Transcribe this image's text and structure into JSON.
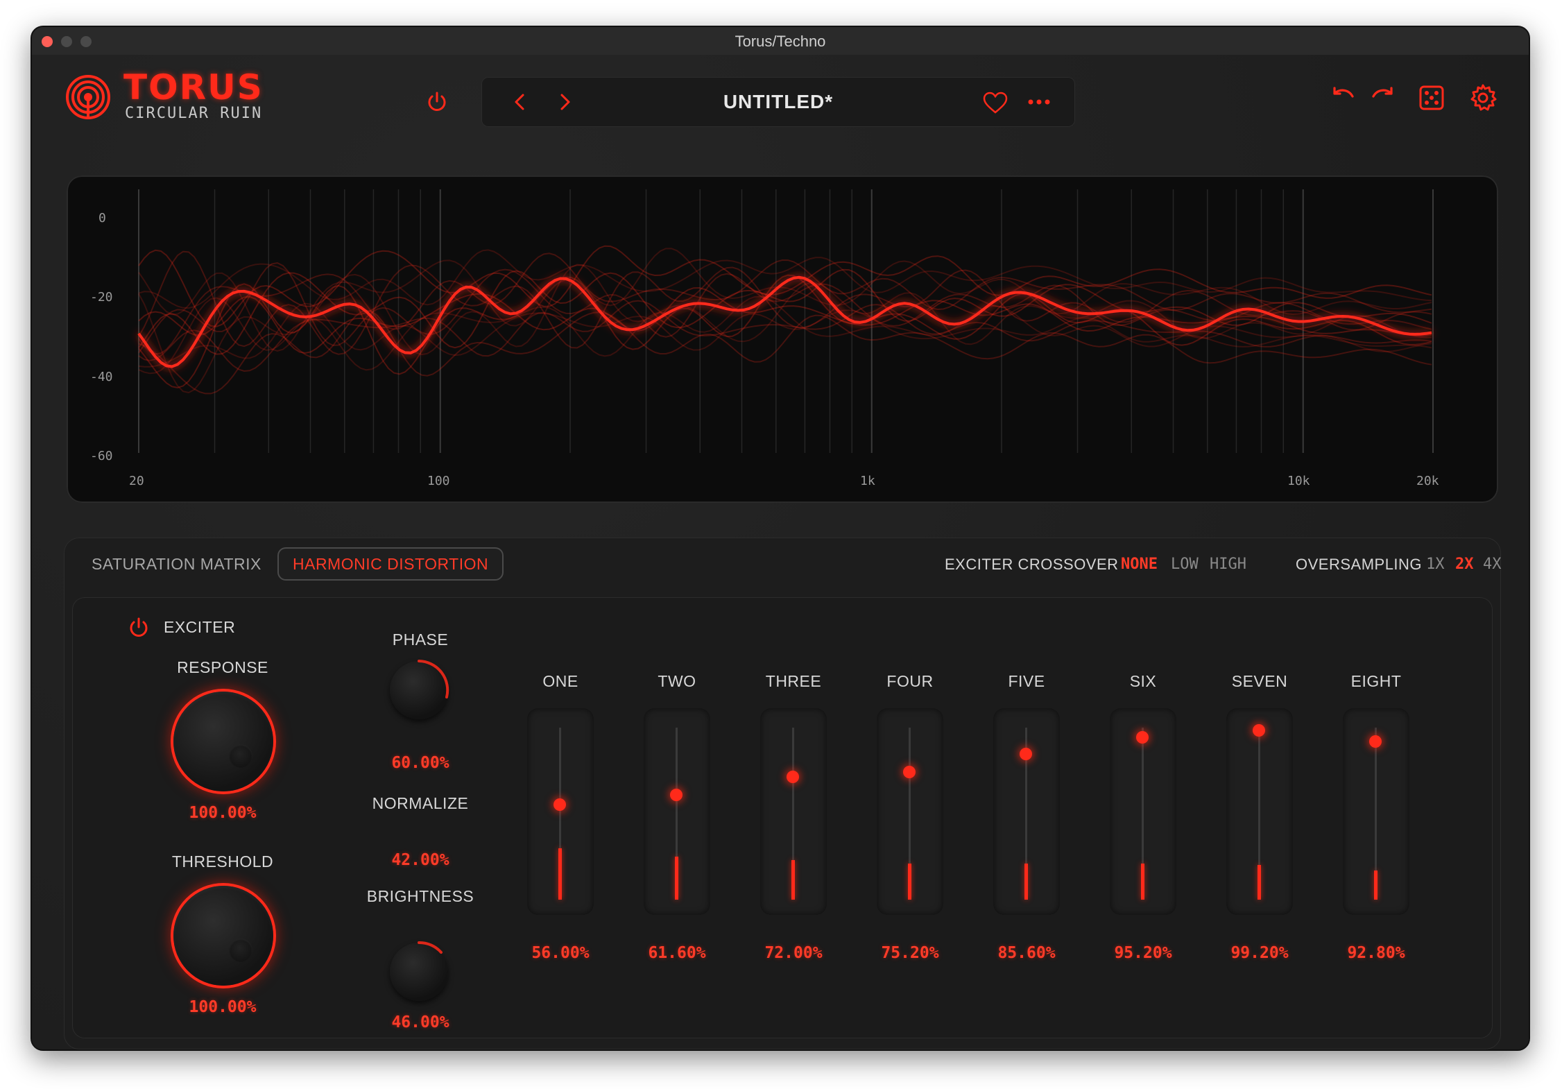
{
  "window": {
    "title": "Torus/Techno"
  },
  "header": {
    "logo_title": "TORUS",
    "logo_subtitle": "CIRCULAR RUIN",
    "preset_name": "UNTITLED*"
  },
  "spectrum": {
    "y_labels": [
      "0",
      "-20",
      "-40",
      "-60"
    ],
    "x_labels": [
      "20",
      "100",
      "1k",
      "10k",
      "20k"
    ]
  },
  "tabs": [
    {
      "label": "SATURATION MATRIX",
      "active": false
    },
    {
      "label": "HARMONIC DISTORTION",
      "active": true
    }
  ],
  "exciter_crossover": {
    "label": "EXCITER CROSSOVER",
    "options": [
      "NONE",
      "LOW",
      "HIGH"
    ],
    "selected": "NONE"
  },
  "oversampling": {
    "label": "OVERSAMPLING",
    "options": [
      "1X",
      "2X",
      "4X"
    ],
    "selected": "2X"
  },
  "exciter": {
    "label": "EXCITER",
    "response": {
      "label": "RESPONSE",
      "value": "100.00%"
    },
    "threshold": {
      "label": "THRESHOLD",
      "value": "100.00%"
    },
    "phase": {
      "label": "PHASE",
      "value": "60.00%"
    },
    "normalize": {
      "label": "NORMALIZE",
      "value": "42.00%"
    },
    "brightness": {
      "label": "BRIGHTNESS",
      "value": "46.00%"
    }
  },
  "harmonics": [
    {
      "label": "ONE",
      "value": "56.00%",
      "level": 0.56,
      "meter": 0.3
    },
    {
      "label": "TWO",
      "value": "61.60%",
      "level": 0.616,
      "meter": 0.25
    },
    {
      "label": "THREE",
      "value": "72.00%",
      "level": 0.72,
      "meter": 0.23
    },
    {
      "label": "FOUR",
      "value": "75.20%",
      "level": 0.752,
      "meter": 0.21
    },
    {
      "label": "FIVE",
      "value": "85.60%",
      "level": 0.856,
      "meter": 0.21
    },
    {
      "label": "SIX",
      "value": "95.20%",
      "level": 0.952,
      "meter": 0.21
    },
    {
      "label": "SEVEN",
      "value": "99.20%",
      "level": 0.992,
      "meter": 0.2
    },
    {
      "label": "EIGHT",
      "value": "92.80%",
      "level": 0.928,
      "meter": 0.17
    }
  ],
  "colors": {
    "accent": "#ff2a1a",
    "background": "#1f1f1f",
    "text": "#d8d8d8"
  }
}
